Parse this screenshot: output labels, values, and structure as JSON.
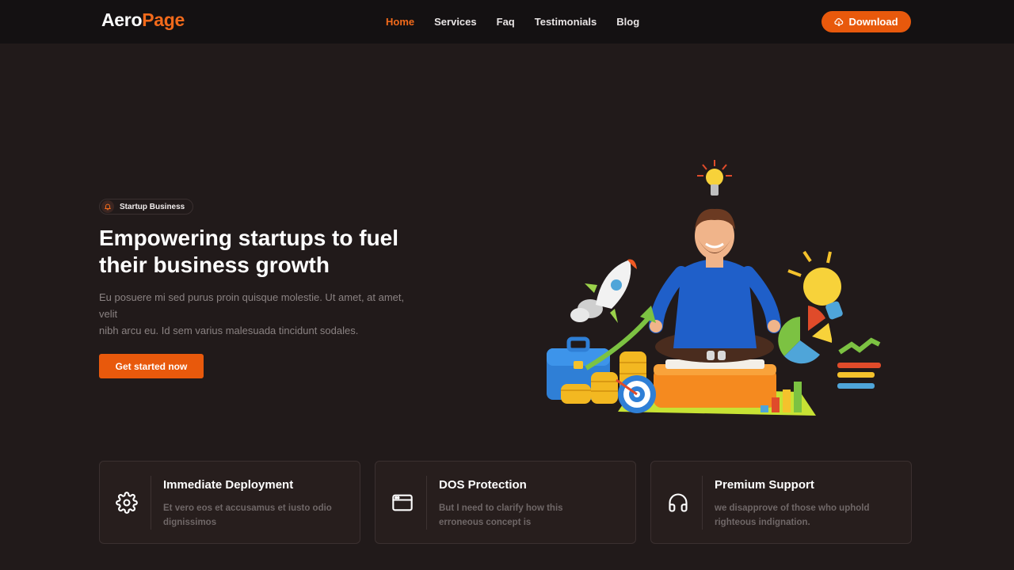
{
  "brand": {
    "part1": "Aero",
    "part2": "Page"
  },
  "nav": {
    "items": [
      {
        "label": "Home",
        "active": true
      },
      {
        "label": "Services"
      },
      {
        "label": "Faq"
      },
      {
        "label": "Testimonials"
      },
      {
        "label": "Blog"
      }
    ],
    "download_label": "Download",
    "download_icon": "cloud-download-icon"
  },
  "hero": {
    "badge": "Startup Business",
    "badge_icon": "bell-icon",
    "title_line1": "Empowering startups to fuel",
    "title_line2": "their business growth",
    "desc_line1": "Eu posuere mi sed purus proin quisque molestie. Ut amet, at amet,",
    "desc_line2": "velit",
    "desc_line3": "nibh arcu eu. Id sem varius malesuada tincidunt sodales.",
    "cta": "Get started now"
  },
  "features": [
    {
      "title": "Immediate Deployment",
      "line1": "Et vero eos et accusamus et iusto odio",
      "line2": "dignissimos",
      "icon": "gear-icon"
    },
    {
      "title": "DOS Protection",
      "line1": "But I need to clarify how this",
      "line2": "erroneous concept is",
      "icon": "browser-window-icon"
    },
    {
      "title": "Premium Support",
      "line1": "we disapprove of those who uphold",
      "line2": "righteous indignation.",
      "icon": "headphones-icon"
    }
  ],
  "colors": {
    "accent": "#e8590c",
    "background": "#211a1a",
    "navbar": "#141112",
    "card": "#271e1d"
  }
}
